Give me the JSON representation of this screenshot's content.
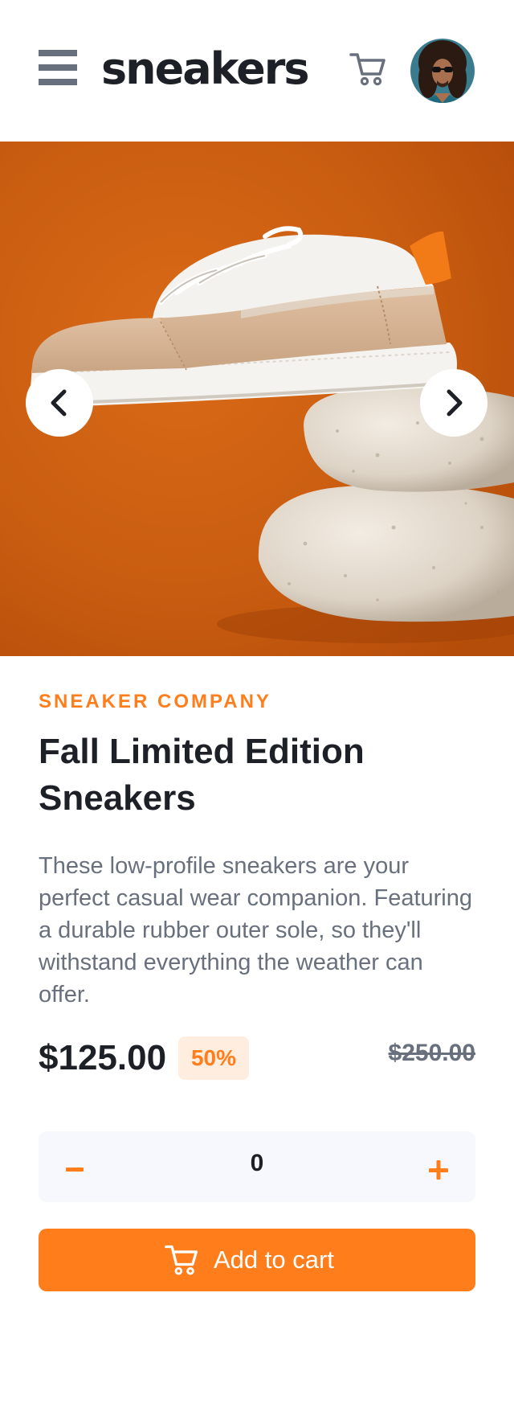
{
  "header": {
    "logo": "sneakers",
    "menu_icon": "hamburger-menu-icon",
    "cart_icon": "cart-icon",
    "avatar_icon": "user-avatar"
  },
  "gallery": {
    "image_subject": "white and beige sneaker resting on stacked stones against an orange backdrop",
    "prev_icon": "chevron-left-icon",
    "next_icon": "chevron-right-icon"
  },
  "product": {
    "company": "SNEAKER COMPANY",
    "title": "Fall Limited Edition Sneakers",
    "description": "These low-profile sneakers are your perfect casual wear companion. Featuring a durable rubber outer sole, so they'll withstand everything the weather can offer.",
    "price": "$125.00",
    "discount": "50%",
    "original_price": "$250.00"
  },
  "quantity": {
    "value": "0",
    "minus_icon": "minus-icon",
    "plus_icon": "plus-icon"
  },
  "actions": {
    "add_to_cart": "Add to cart"
  },
  "colors": {
    "accent": "#ff7e1b",
    "accent_pale": "#ffede0",
    "dark_text": "#1d2026",
    "grey_text": "#69707d",
    "light_bg": "#f6f8fd"
  }
}
